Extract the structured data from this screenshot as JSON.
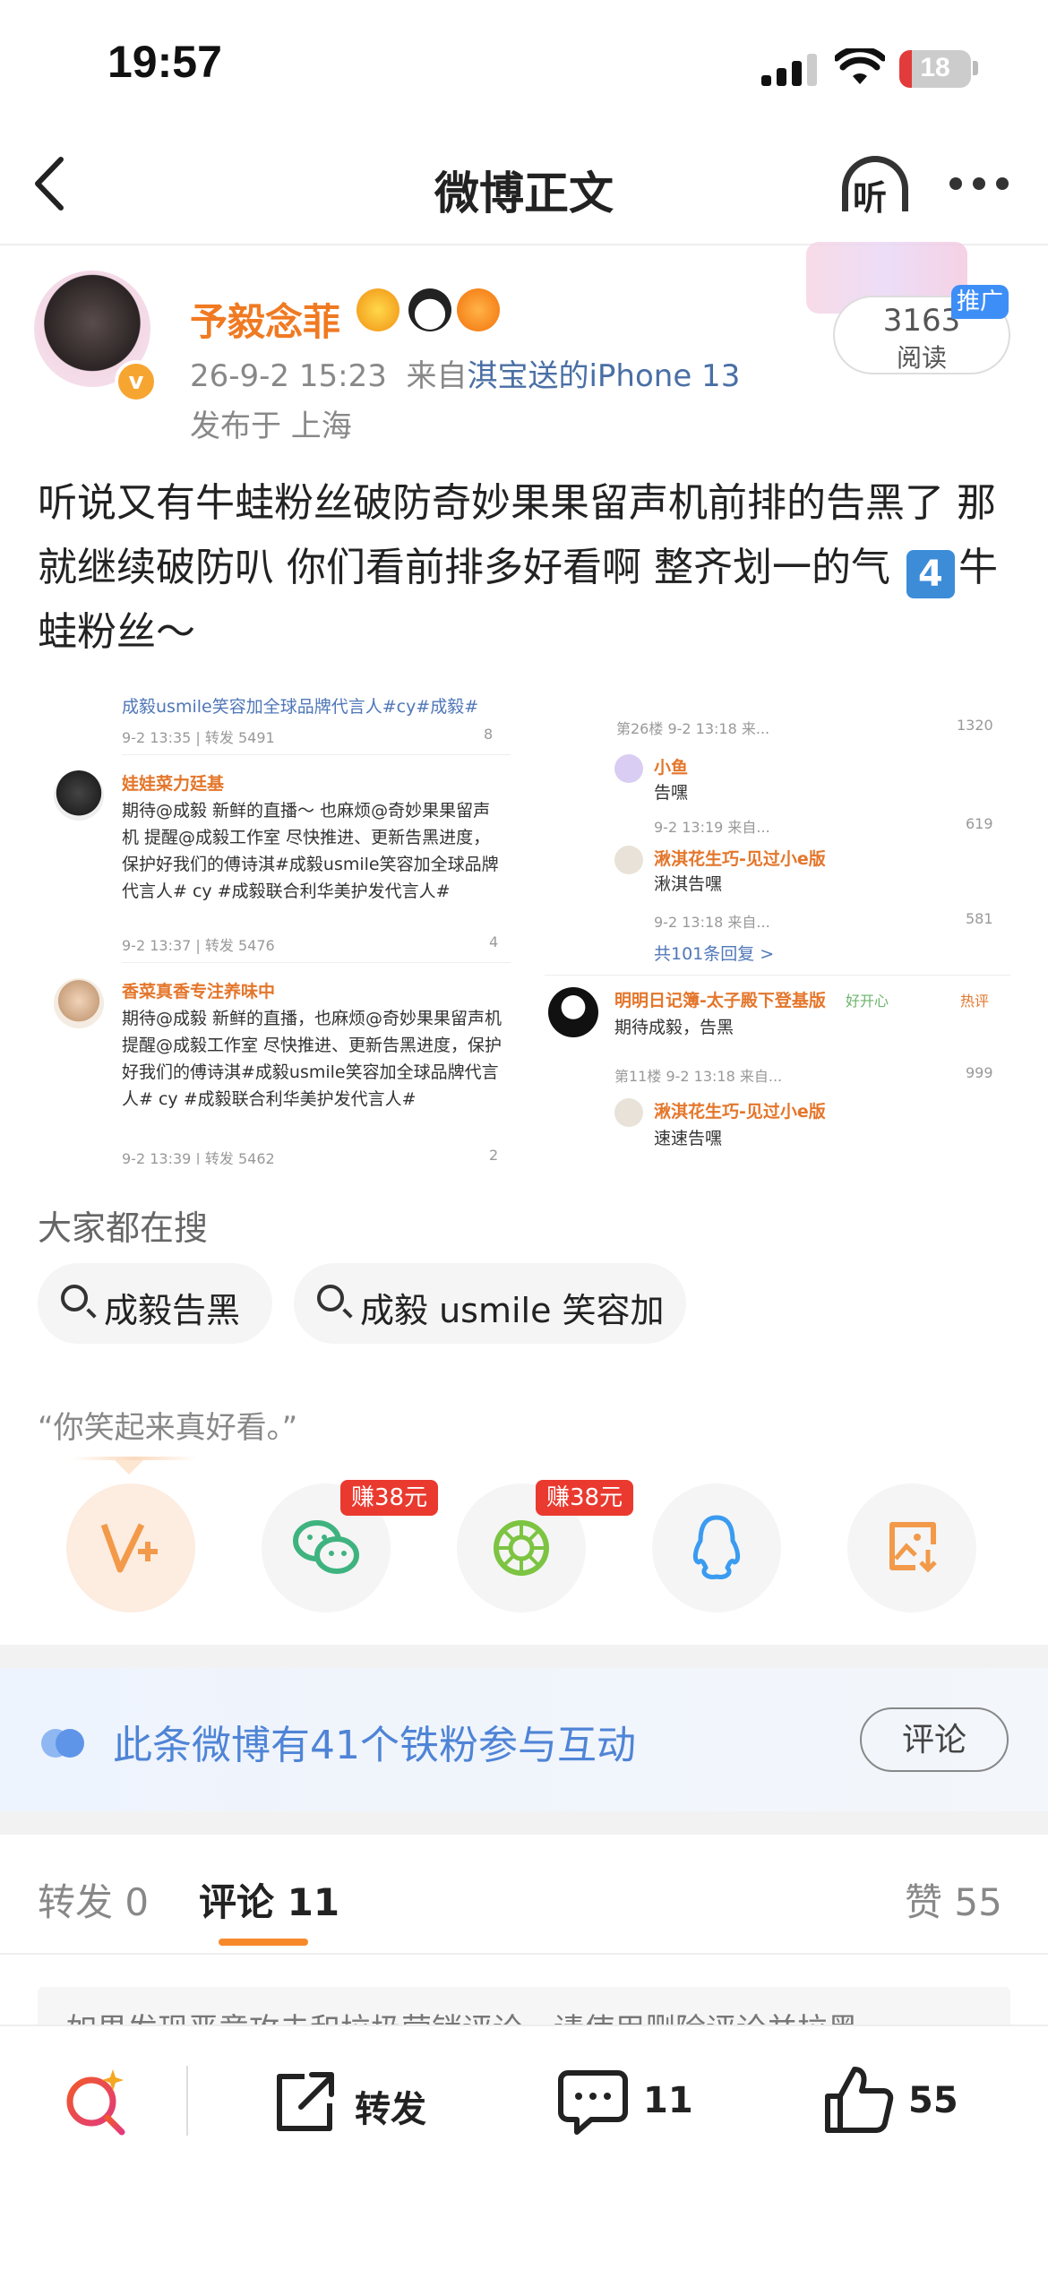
{
  "status_bar": {
    "time": "19:57",
    "battery": "18"
  },
  "nav": {
    "title": "微博正文",
    "listen_label": "听"
  },
  "author": {
    "name": "予毅念菲",
    "time": "26-9-2 15:23",
    "source_prefix": "来自",
    "source": "淇宝送的iPhone 13",
    "location": "发布于 上海",
    "reads": "3163",
    "reads_label": "阅读",
    "promo_label": "推广"
  },
  "post": {
    "text_before": "听说又有牛蛙粉丝破防奇妙果果留声机前排的告黑了 那就继续破防叭 你们看前排多好看啊 整齐划一的气 ",
    "number_emoji": "4",
    "text_after": "牛蛙粉丝～"
  },
  "screenshot_left": {
    "top_tag": "成毅usmile笑容加全球品牌代言人#cy#成毅#",
    "top_meta": "9-2 13:35 | 转发 5491",
    "top_likes": "8",
    "c1_name": "娃娃菜力廷基",
    "c1_text": "期待@成毅 新鲜的直播～ 也麻烦@奇妙果果留声机 提醒@成毅工作室 尽快推进、更新告黑进度，保护好我们的傅诗淇#成毅usmile笑容加全球品牌代言人# cy #成毅联合利华美护发代言人#",
    "c1_meta": "9-2 13:37 | 转发 5476",
    "c1_likes": "4",
    "c2_name": "香菜真香专注养味中",
    "c2_text": "期待@成毅 新鲜的直播，也麻烦@奇妙果果留声机 提醒@成毅工作室 尽快推进、更新告黑进度，保护好我们的傅诗淇#成毅usmile笑容加全球品牌代言人# cy #成毅联合利华美护发代言人#",
    "c2_meta": "9-2 13:39 | 转发 5462",
    "c2_likes": "2"
  },
  "screenshot_right": {
    "top_meta": "第26楼 9-2 13:18 来...",
    "top_likes": "1320",
    "r1_name": "小鱼",
    "r1_text": "告嘿",
    "r1_meta": "9-2 13:19 来自...",
    "r1_likes": "619",
    "r2_name": "湫淇花生巧-见过小e版",
    "r2_text": "湫淇告嘿",
    "r2_meta": "9-2 13:18 来自...",
    "r2_likes": "581",
    "more_replies": "共101条回复 >",
    "r3_name": "明明日记簿-太子殿下登基版",
    "r3_badge": "好开心",
    "r3_tag": "热评",
    "r3_text": "期待成毅，告黑",
    "r3_meta": "第11楼 9-2 13:18 来自...",
    "r3_likes": "999",
    "r4_name": "湫淇花生巧-见过小e版",
    "r4_text": "速速告嘿"
  },
  "search": {
    "title": "大家都在搜",
    "chips": [
      "成毅告黑",
      "成毅 usmile 笑容加"
    ]
  },
  "quote": "“你笑起来真好看。”",
  "share": {
    "earn_1": "赚38元",
    "earn_2": "赚38元"
  },
  "fans_banner": {
    "text": "此条微博有41个铁粉参与互动",
    "button": "评论"
  },
  "tabs": {
    "repost": "转发 0",
    "comment": "评论 11",
    "like": "赞 55"
  },
  "notice": "如果发现恶意攻击和垃圾营销评论，请使用删除评论并拉黑",
  "bottom_bar": {
    "repost": "转发",
    "comments": "11",
    "likes": "55"
  },
  "colors": {
    "accent": "#f7892b",
    "link": "#4f84d6",
    "name": "#f07a22",
    "earn": "#ea3a2f"
  }
}
